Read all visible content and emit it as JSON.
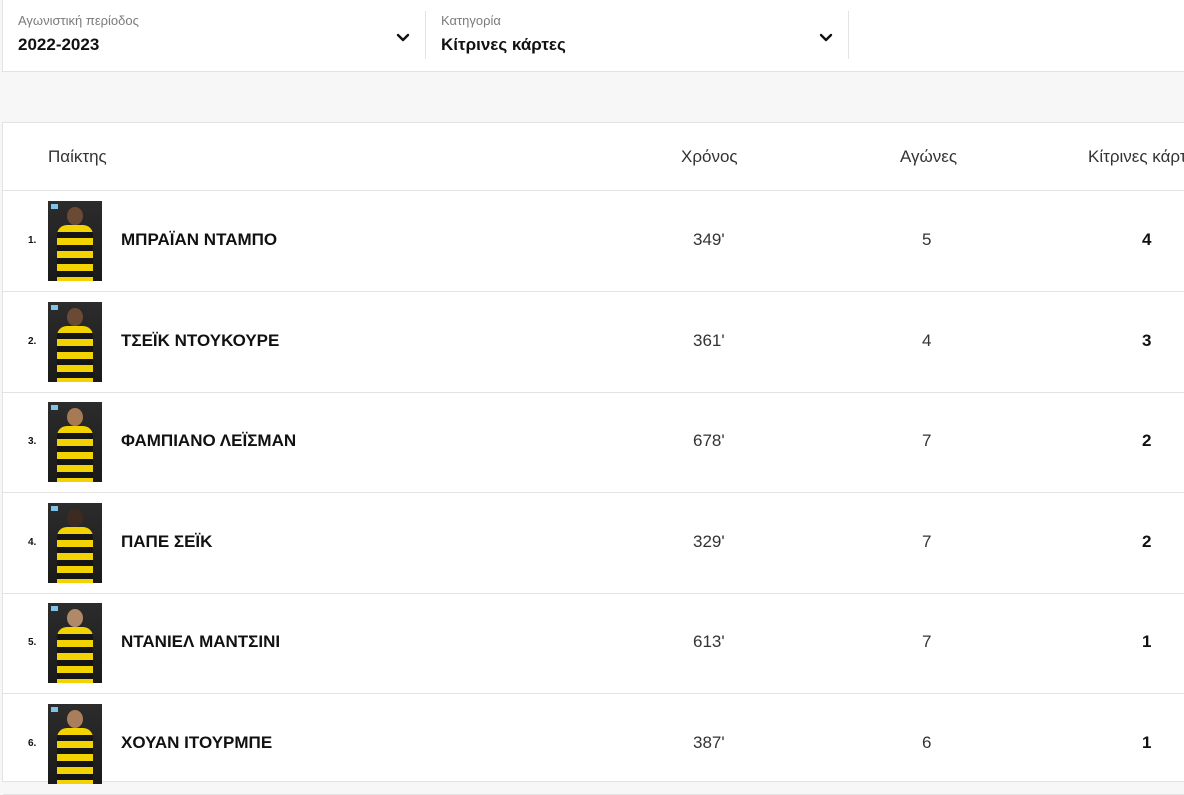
{
  "filters": {
    "season": {
      "label": "Αγωνιστική περίοδος",
      "value": "2022-2023",
      "icon": "chevron-down-icon"
    },
    "category": {
      "label": "Κατηγορία",
      "value": "Κίτρινες κάρτες",
      "icon": "chevron-down-icon"
    }
  },
  "table": {
    "headers": {
      "player": "Παίκτης",
      "minutes": "Χρόνος",
      "games": "Αγώνες",
      "cards": "Κίτρινες κάρτες"
    },
    "rows": [
      {
        "rank": "1.",
        "name": "ΜΠΡΑΪΑΝ ΝΤΑΜΠΟ",
        "minutes": "349'",
        "games": "5",
        "cards": "4"
      },
      {
        "rank": "2.",
        "name": "ΤΣΕΪΚ ΝΤΟΥΚΟΥΡΕ",
        "minutes": "361'",
        "games": "4",
        "cards": "3"
      },
      {
        "rank": "3.",
        "name": "ΦΑΜΠΙΑΝΟ ΛΕΪΣΜΑΝ",
        "minutes": "678'",
        "games": "7",
        "cards": "2"
      },
      {
        "rank": "4.",
        "name": "ΠΑΠΕ ΣΕΪΚ",
        "minutes": "329'",
        "games": "7",
        "cards": "2"
      },
      {
        "rank": "5.",
        "name": "ΝΤΑΝΙΕΛ ΜΑΝΤΣΙΝΙ",
        "minutes": "613'",
        "games": "7",
        "cards": "1"
      },
      {
        "rank": "6.",
        "name": "ΧΟΥΑΝ ΙΤΟΥΡΜΠΕ",
        "minutes": "387'",
        "games": "6",
        "cards": "1"
      }
    ]
  },
  "colors": {
    "kit_yellow": "#f2d200",
    "kit_black": "#151515"
  }
}
